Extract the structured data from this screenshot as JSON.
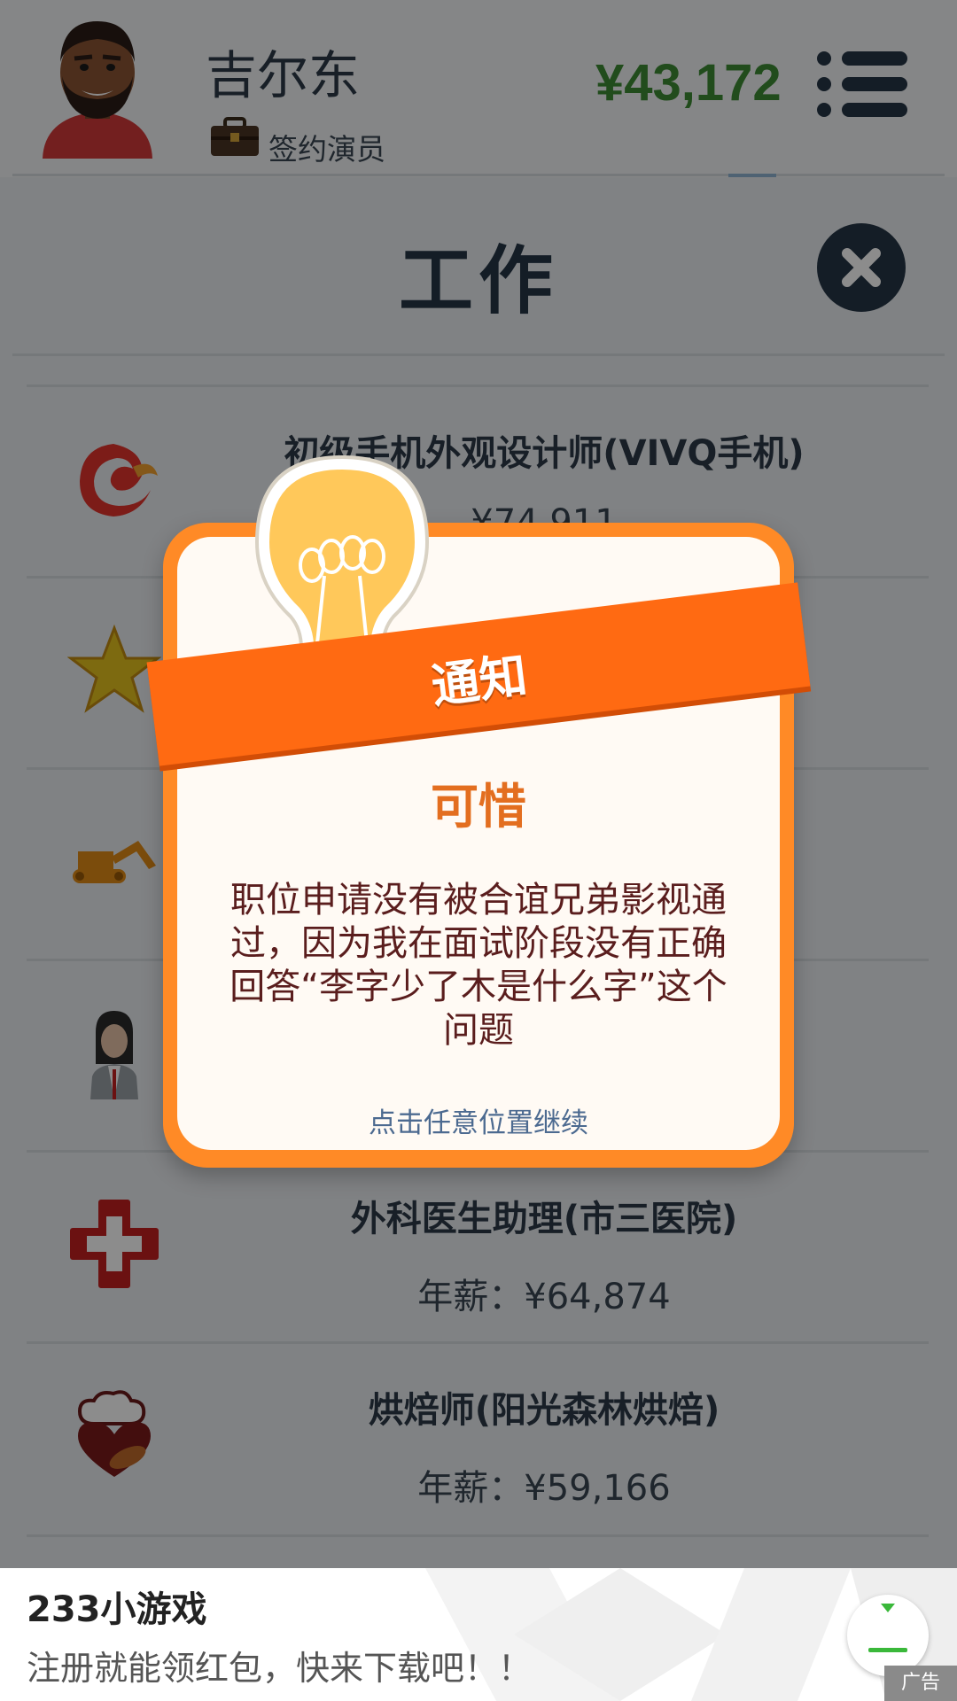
{
  "header": {
    "player_name": "吉尔东",
    "status": "签约演员",
    "money": "¥43,172"
  },
  "page": {
    "title": "工作"
  },
  "jobs": [
    {
      "title": "初级手机外观设计师(VIVQ手机)",
      "salary": "¥74,911",
      "icon": "phoenix-logo-icon"
    },
    {
      "title": "",
      "salary": "",
      "icon": "star-icon"
    },
    {
      "title": "",
      "salary": "",
      "icon": "excavator-icon"
    },
    {
      "title": "",
      "salary": "",
      "icon": "businesswoman-icon"
    },
    {
      "title": "外科医生助理(市三医院)",
      "salary": "年薪：¥64,874",
      "icon": "medical-cross-icon"
    },
    {
      "title": "烘焙师(阳光森林烘焙)",
      "salary": "年薪：¥59,166",
      "icon": "chef-heart-icon"
    }
  ],
  "dialog": {
    "banner": "通知",
    "heading": "可惜",
    "message": "职位申请没有被合谊兄弟影视通过，因为我在面试阶段没有正确回答“李字少了木是什么字”这个问题",
    "hint": "点击任意位置继续"
  },
  "ad": {
    "title": "233小游戏",
    "subtitle": "注册就能领红包，快来下载吧！！",
    "badge": "广告"
  },
  "colors": {
    "money": "#3c8a34",
    "dark_navy": "#253545",
    "dialog_orange": "#ff8a26",
    "ribbon_orange": "#ff6a12",
    "heading_orange": "#e36e1f"
  }
}
